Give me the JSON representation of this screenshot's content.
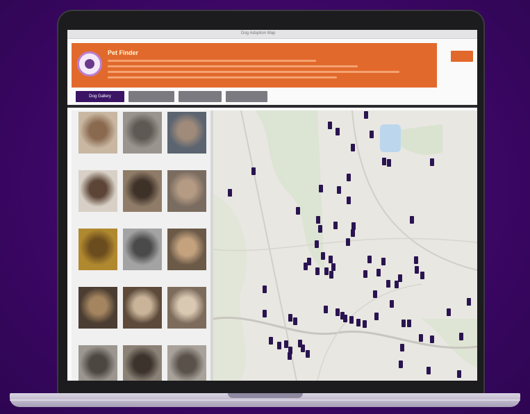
{
  "browser": {
    "title": "Dog Adoption Map"
  },
  "banner": {
    "title": "Pet Finder",
    "color": "#e2692c"
  },
  "tabs": [
    {
      "label": "Dog Gallery",
      "active": true
    },
    {
      "label": "",
      "active": false
    },
    {
      "label": "",
      "active": false
    },
    {
      "label": "",
      "active": false
    }
  ],
  "gallery": {
    "items": [
      {
        "icon": "dog-photo"
      },
      {
        "icon": "dog-photo"
      },
      {
        "icon": "dog-photo"
      },
      {
        "icon": "dog-photo"
      },
      {
        "icon": "dog-photo"
      },
      {
        "icon": "dog-photo"
      },
      {
        "icon": "dog-photo"
      },
      {
        "icon": "dog-photo"
      },
      {
        "icon": "dog-photo"
      },
      {
        "icon": "dog-photo"
      },
      {
        "icon": "dog-photo"
      },
      {
        "icon": "dog-photo"
      },
      {
        "icon": "dog-photo"
      },
      {
        "icon": "dog-photo"
      },
      {
        "icon": "dog-photo"
      }
    ]
  },
  "map": {
    "marker_icon": "map-pin-icon",
    "marker_color": "#2a1450"
  },
  "colors": {
    "background": "#3b0764",
    "accent": "#e2692c",
    "active_tab": "#3b1466"
  }
}
